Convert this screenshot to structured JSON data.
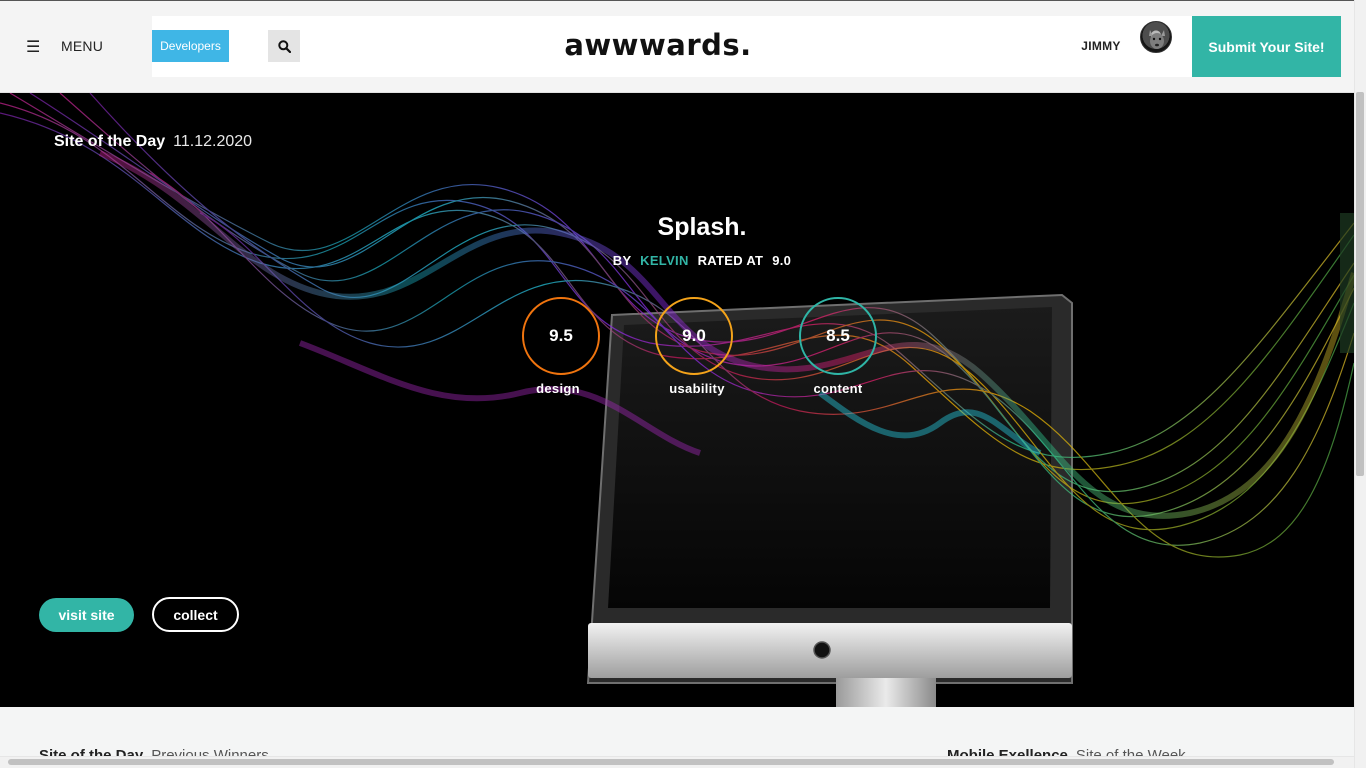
{
  "header": {
    "menu_label": "MENU",
    "developers_label": "Developers",
    "logo_text": "awwwards.",
    "user_name": "JIMMY",
    "submit_label": "Submit Your Site!"
  },
  "hero": {
    "badge_label": "Site of the Day",
    "badge_date": "11.12.2020",
    "site_title": "Splash.",
    "by_label": "BY",
    "author": "KELVIN",
    "rated_label": "RATED  AT",
    "rating": "9.0",
    "scores": [
      {
        "value": "9.5",
        "label": "design",
        "color": "#f0740e"
      },
      {
        "value": "9.0",
        "label": "usability",
        "color": "#f4a31a"
      },
      {
        "value": "8.5",
        "label": "content",
        "color": "#2fb5a6"
      }
    ],
    "visit_label": "visit site",
    "collect_label": "collect"
  },
  "below": {
    "left_strong": "Site of the Day",
    "left_muted": "Previous Winners",
    "right_strong": "Mobile Exellence",
    "right_muted": "Site of the Week"
  },
  "colors": {
    "accent": "#32b5a6",
    "developers": "#3fb6e6"
  },
  "icons": {
    "menu": "hamburger-icon",
    "search": "search-icon"
  }
}
